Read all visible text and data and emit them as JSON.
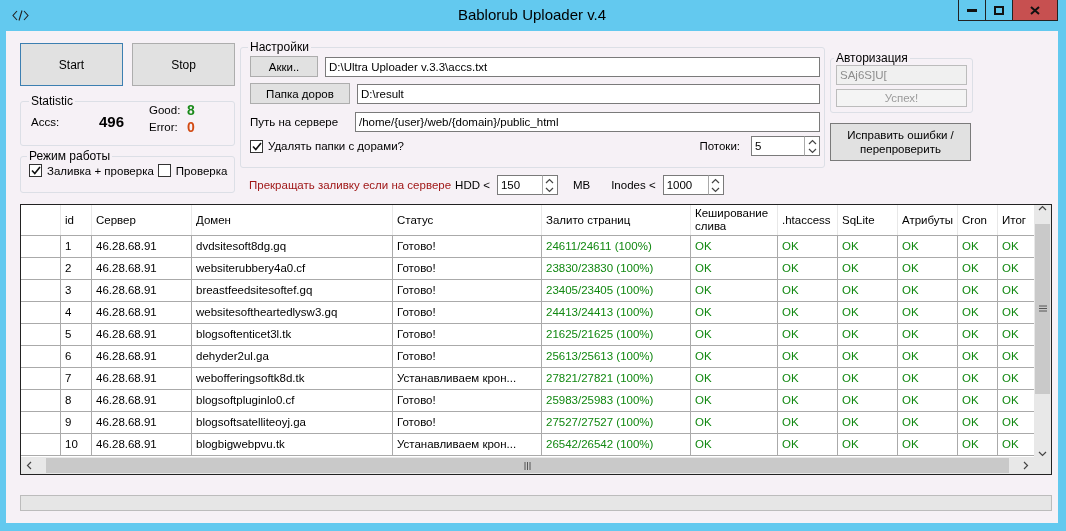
{
  "window": {
    "title": "Bablorub Uploader v.4"
  },
  "buttons": {
    "start": "Start",
    "stop": "Stop"
  },
  "statistic": {
    "title": "Statistic",
    "accs_label": "Accs:",
    "accs_value": "496",
    "items": [
      {
        "label": "Good:",
        "value": "8",
        "kind": "good"
      },
      {
        "label": "Error:",
        "value": "0",
        "kind": "error"
      }
    ]
  },
  "mode": {
    "title": "Режим работы",
    "options": [
      {
        "label": "Заливка + проверка",
        "checked": true
      },
      {
        "label": "Проверка",
        "checked": false
      }
    ]
  },
  "settings": {
    "title": "Настройки",
    "accs_button": "Акки..",
    "accs_path": "D:\\Ultra Uploader v.3.3\\accs.txt",
    "doors_button": "Папка доров",
    "doors_path": "D:\\result",
    "server_path_label": "Путь на сервере",
    "server_path": "/home/{user}/web/{domain}/public_html",
    "delete_label": "Удалять папки с дорами?",
    "delete_checked": true,
    "threads_label": "Потоки:",
    "threads": "5"
  },
  "limits": {
    "warning": "Прекращать заливку если на сервере",
    "hdd_label": "HDD <",
    "hdd": "150",
    "hdd_unit": "MB",
    "inodes_label": "Inodes <",
    "inodes": "1000"
  },
  "auth": {
    "title": "Авторизация",
    "key": "SAj6S]U[",
    "key_disabled": true,
    "button": "Успех!",
    "button_disabled": true
  },
  "fix_button": "Исправить ошибки / перепроверить",
  "table": {
    "columns": [
      {
        "label": "id",
        "kind": "text"
      },
      {
        "label": "Сервер",
        "kind": "text"
      },
      {
        "label": "Домен",
        "kind": "text"
      },
      {
        "label": "Статус",
        "kind": "text"
      },
      {
        "label": "Залито страниц",
        "kind": "result"
      },
      {
        "label": "Кеширование слива",
        "kind": "result"
      },
      {
        "label": ".htaccess",
        "kind": "result"
      },
      {
        "label": "SqLite",
        "kind": "result"
      },
      {
        "label": "Атрибуты",
        "kind": "result"
      },
      {
        "label": "Cron",
        "kind": "result"
      },
      {
        "label": "Итог",
        "kind": "result"
      }
    ],
    "rows": [
      [
        "1",
        "46.28.68.91",
        "dvdsitesoft8dg.gq",
        "Готово!",
        "24611/24611 (100%)",
        "OK",
        "OK",
        "OK",
        "OK",
        "OK",
        "OK"
      ],
      [
        "2",
        "46.28.68.91",
        "websiterubbery4a0.cf",
        "Готово!",
        "23830/23830 (100%)",
        "OK",
        "OK",
        "OK",
        "OK",
        "OK",
        "OK"
      ],
      [
        "3",
        "46.28.68.91",
        "breastfeedsitesoftef.gq",
        "Готово!",
        "23405/23405 (100%)",
        "OK",
        "OK",
        "OK",
        "OK",
        "OK",
        "OK"
      ],
      [
        "4",
        "46.28.68.91",
        "websitesoftheartedlysw3.gq",
        "Готово!",
        "24413/24413 (100%)",
        "OK",
        "OK",
        "OK",
        "OK",
        "OK",
        "OK"
      ],
      [
        "5",
        "46.28.68.91",
        "blogsoftenticet3l.tk",
        "Готово!",
        "21625/21625 (100%)",
        "OK",
        "OK",
        "OK",
        "OK",
        "OK",
        "OK"
      ],
      [
        "6",
        "46.28.68.91",
        "dehyder2ul.ga",
        "Готово!",
        "25613/25613 (100%)",
        "OK",
        "OK",
        "OK",
        "OK",
        "OK",
        "OK"
      ],
      [
        "7",
        "46.28.68.91",
        "webofferingsoftk8d.tk",
        "Устанавливаем крон...",
        "27821/27821 (100%)",
        "OK",
        "OK",
        "OK",
        "OK",
        "OK",
        "OK"
      ],
      [
        "8",
        "46.28.68.91",
        "blogsoftpluginlo0.cf",
        "Готово!",
        "25983/25983 (100%)",
        "OK",
        "OK",
        "OK",
        "OK",
        "OK",
        "OK"
      ],
      [
        "9",
        "46.28.68.91",
        "blogsoftsatelliteoyj.ga",
        "Готово!",
        "27527/27527 (100%)",
        "OK",
        "OK",
        "OK",
        "OK",
        "OK",
        "OK"
      ],
      [
        "10",
        "46.28.68.91",
        "blogbigwebpvu.tk",
        "Устанавливаем крон...",
        "26542/26542 (100%)",
        "OK",
        "OK",
        "OK",
        "OK",
        "OK",
        "OK"
      ]
    ]
  },
  "progress": {
    "level": 0
  }
}
